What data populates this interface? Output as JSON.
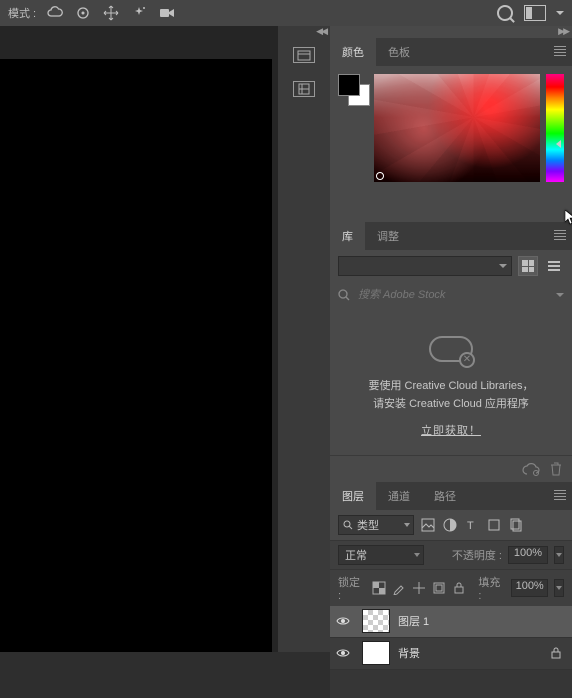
{
  "topbar": {
    "mode_label": "模式 :",
    "icons": [
      "cloud-icon",
      "target-icon",
      "move-icon",
      "sparkle-icon",
      "video-icon"
    ]
  },
  "color_panel": {
    "tabs": {
      "color": "颜色",
      "swatches": "色板"
    }
  },
  "libraries_panel": {
    "tabs": {
      "library": "库",
      "adjustments": "调整"
    },
    "stock_placeholder": "搜索 Adobe Stock",
    "cc_line1": "要使用 Creative Cloud Libraries，",
    "cc_line2": "请安装 Creative Cloud 应用程序",
    "cc_link": "立即获取！"
  },
  "layers_panel": {
    "tabs": {
      "layers": "图层",
      "channels": "通道",
      "paths": "路径"
    },
    "type_label": "类型",
    "blend_mode": "正常",
    "opacity_label": "不透明度 :",
    "opacity_value": "100%",
    "lock_label": "锁定 :",
    "fill_label": "填充 :",
    "fill_value": "100%",
    "layers": [
      {
        "name": "图层 1",
        "locked": false,
        "checker": true
      },
      {
        "name": "背景",
        "locked": true,
        "checker": false
      }
    ]
  }
}
